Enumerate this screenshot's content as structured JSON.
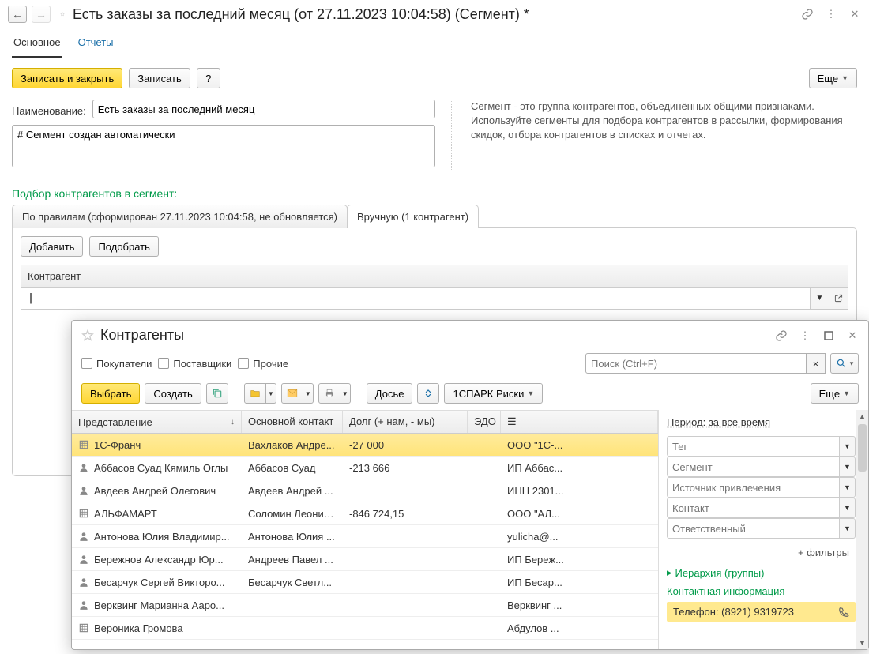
{
  "title": "Есть заказы за последний месяц (от 27.11.2023 10:04:58) (Сегмент) *",
  "mainTabs": {
    "main": "Основное",
    "reports": "Отчеты"
  },
  "buttons": {
    "saveClose": "Записать и закрыть",
    "save": "Записать",
    "help": "?",
    "more": "Еще",
    "add": "Добавить",
    "pick": "Подобрать",
    "select": "Выбрать",
    "create": "Создать",
    "dossier": "Досье",
    "spark": "1СПАРК Риски"
  },
  "labels": {
    "name": "Наименование:",
    "counterparty": "Контрагент"
  },
  "values": {
    "name": "Есть заказы за последний месяц",
    "comment": "# Сегмент создан автоматически",
    "help": "Сегмент - это группа контрагентов, объединённых общими признаками. Используйте сегменты для подбора контрагентов в рассылки, формирования скидок, отбора контрагентов в списках и отчетах."
  },
  "sectionTitle": "Подбор контрагентов в сегмент:",
  "segTabs": {
    "rules": "По правилам (сформирован 27.11.2023 10:04:58, не обновляется)",
    "manual": "Вручную (1 контрагент)"
  },
  "popup": {
    "title": "Контрагенты",
    "checks": {
      "buyers": "Покупатели",
      "suppliers": "Поставщики",
      "other": "Прочие"
    },
    "searchPlaceholder": "Поиск (Ctrl+F)",
    "columns": {
      "rep": "Представление",
      "contact": "Основной контакт",
      "debt": "Долг (+ нам, - мы)",
      "edo": "ЭДО"
    },
    "rows": [
      {
        "icon": "org",
        "rep": "1С-Франч",
        "contact": "Вахлаков Андре...",
        "debt": "-27 000",
        "last": "ООО \"1С-...",
        "sel": true
      },
      {
        "icon": "person",
        "rep": "Аббасов Суад Кямиль Оглы",
        "contact": "Аббасов Суад",
        "debt": "-213 666",
        "last": "ИП Аббас..."
      },
      {
        "icon": "person",
        "rep": "Авдеев Андрей Олегович",
        "contact": "Авдеев Андрей ...",
        "debt": "",
        "last": "ИНН 2301..."
      },
      {
        "icon": "org",
        "rep": "АЛЬФАМАРТ",
        "contact": "Соломин Леонид...",
        "debt": "-846 724,15",
        "last": "ООО \"АЛ..."
      },
      {
        "icon": "person",
        "rep": "Антонова Юлия Владимир...",
        "contact": "Антонова Юлия ...",
        "debt": "",
        "last": "yulicha@..."
      },
      {
        "icon": "person",
        "rep": "Бережнов Александр Юр...",
        "contact": "Андреев Павел ...",
        "debt": "",
        "last": "ИП Береж..."
      },
      {
        "icon": "person",
        "rep": "Бесарчук Сергей Викторо...",
        "contact": "Бесарчук Светл...",
        "debt": "",
        "last": "ИП Бесар..."
      },
      {
        "icon": "person",
        "rep": "Верквинг Марианна Ааро...",
        "contact": "",
        "debt": "",
        "last": "Верквинг ..."
      },
      {
        "icon": "org",
        "rep": "Вероника Громова",
        "contact": "",
        "debt": "",
        "last": "Абдулов ..."
      }
    ],
    "side": {
      "period": "Период: за все время",
      "filters": [
        "Тег",
        "Сегмент",
        "Источник привлечения",
        "Контакт",
        "Ответственный"
      ],
      "filtersLink": "+ фильтры",
      "hierarchy": "Иерархия (группы)",
      "contactHeader": "Контактная информация",
      "phone": "Телефон: (8921) 9319723"
    }
  }
}
